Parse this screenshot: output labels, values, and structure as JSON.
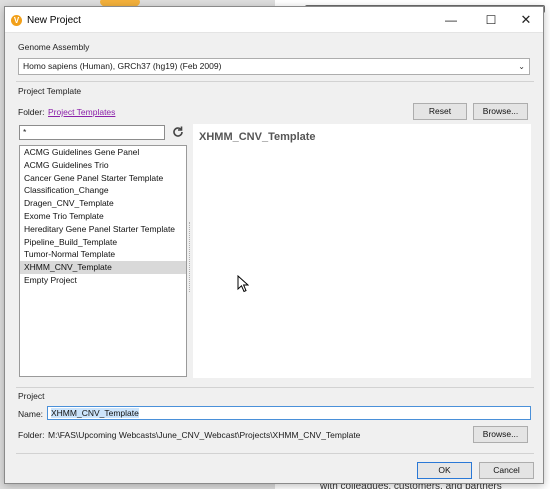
{
  "window": {
    "title": "New Project",
    "app_icon": "V",
    "minimize_glyph": "—",
    "maximize_glyph": "☐",
    "close_glyph": "✕"
  },
  "background": {
    "doc_text": "with colleagues, customers, and partners"
  },
  "genome_assembly": {
    "label": "Genome Assembly",
    "selected": "Homo sapiens (Human), GRCh37 (hg19) (Feb 2009)"
  },
  "project_template": {
    "label": "Project Template",
    "folder_label": "Folder:",
    "folder_link": "Project Templates",
    "reset_label": "Reset",
    "browse_label": "Browse...",
    "filter_value": "*",
    "items": [
      "ACMG Guidelines Gene Panel",
      "ACMG Guidelines Trio",
      "Cancer Gene Panel Starter Template",
      "Classification_Change",
      "Dragen_CNV_Template",
      "Exome Trio Template",
      "Hereditary Gene Panel Starter Template",
      "Pipeline_Build_Template",
      "Tumor-Normal Template",
      "XHMM_CNV_Template",
      "Empty Project"
    ],
    "selected_index": 9,
    "preview_title": "XHMM_CNV_Template"
  },
  "project": {
    "label": "Project",
    "name_label": "Name:",
    "name_value": "XHMM_CNV_Template",
    "folder_label": "Folder:",
    "folder_path": "M:\\FAS\\Upcoming Webcasts\\June_CNV_Webcast\\Projects\\XHMM_CNV_Template",
    "browse_label": "Browse..."
  },
  "footer": {
    "ok_label": "OK",
    "cancel_label": "Cancel"
  },
  "colors": {
    "accent": "#2a78d6",
    "link": "#8b1fa9",
    "app_icon": "#f2a019",
    "selection": "#d9d9d9"
  }
}
